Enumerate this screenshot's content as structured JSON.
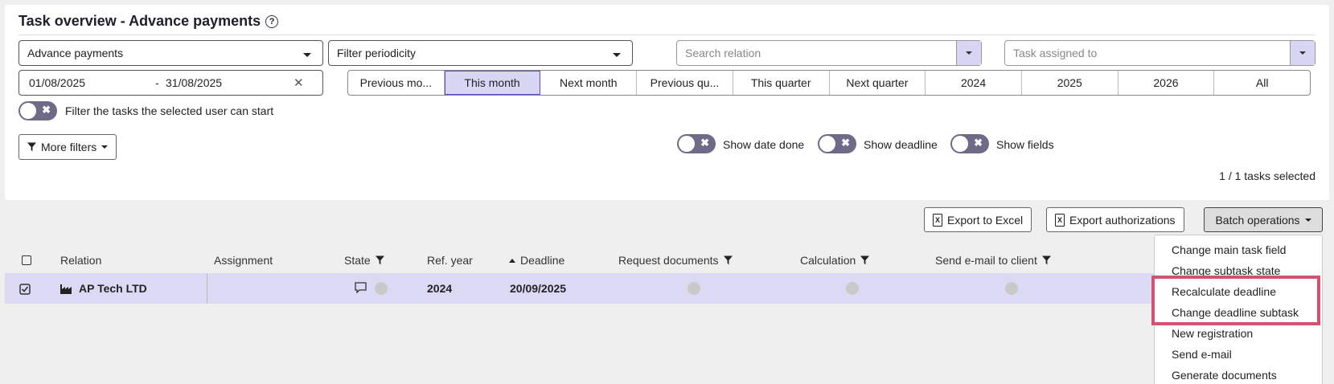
{
  "header": {
    "title": "Task overview - Advance payments",
    "help_icon": "?"
  },
  "filters": {
    "task_type": "Advance payments",
    "periodicity_placeholder": "Filter periodicity",
    "relation_placeholder": "Search relation",
    "assigned_placeholder": "Task assigned to",
    "date_from": "01/08/2025",
    "date_sep": "-",
    "date_to": "31/08/2025",
    "clear_icon": "✕",
    "user_start_label": "Filter the tasks the selected user can start",
    "more_filters": "More filters",
    "periods": [
      "Previous mo...",
      "This month",
      "Next month",
      "Previous qu...",
      "This quarter",
      "Next quarter",
      "2024",
      "2025",
      "2026",
      "All"
    ],
    "active_period": "This month",
    "toggle_x": "✖",
    "show_date_done": "Show date done",
    "show_deadline": "Show deadline",
    "show_fields": "Show fields",
    "selected_count": "1 / 1 tasks selected"
  },
  "toolbar": {
    "export_excel": "Export to Excel",
    "export_auth": "Export authorizations",
    "batch_ops": "Batch operations"
  },
  "table": {
    "columns": [
      "Relation",
      "Assignment",
      "State",
      "Ref. year",
      "Deadline",
      "Request documents",
      "Calculation",
      "Send e-mail to client"
    ],
    "rows": [
      {
        "relation": "AP Tech LTD",
        "assignment": "",
        "ref_year": "2024",
        "deadline": "20/09/2025"
      }
    ]
  },
  "batch_menu": [
    "Change main task field",
    "Change subtask state",
    "Recalculate deadline",
    "Change deadline subtask",
    "New registration",
    "Send e-mail",
    "Generate documents"
  ],
  "colors": {
    "accent_light": "#d9d6f5",
    "toggle": "#6e6a88",
    "highlight": "#d6506f"
  }
}
